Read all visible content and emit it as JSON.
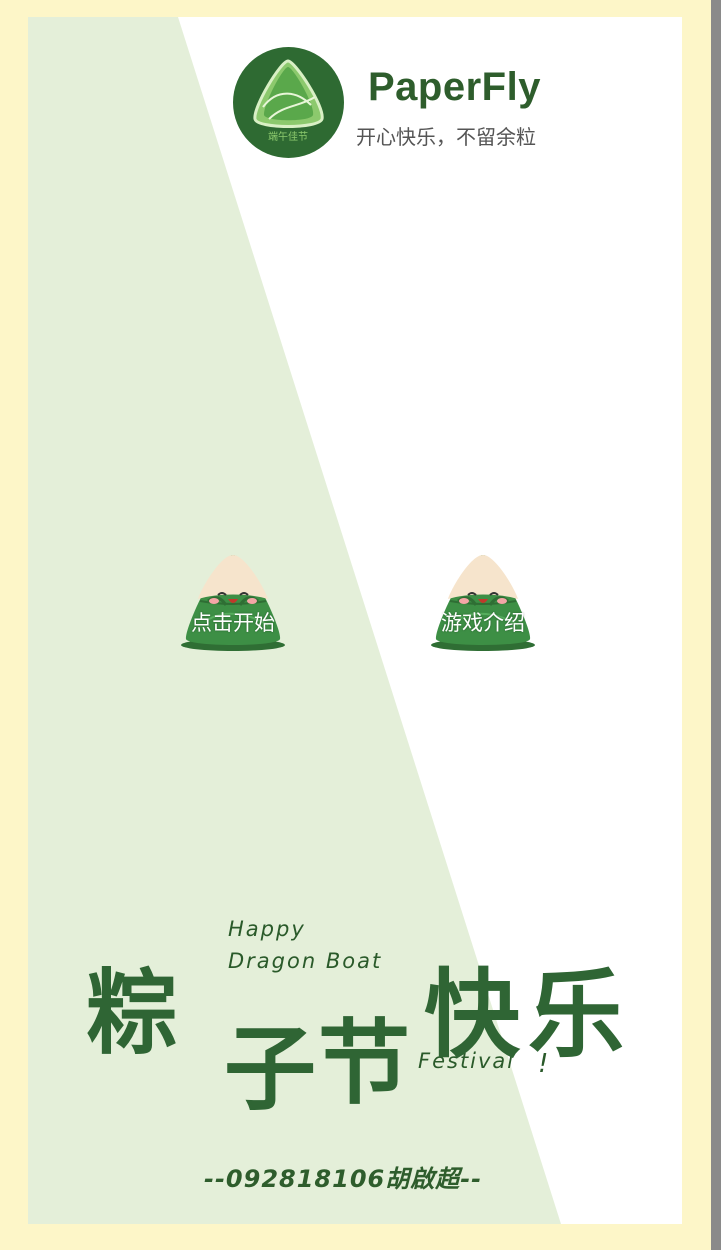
{
  "app": {
    "title": "PaperFly",
    "subtitle": "开心快乐，不留余粒",
    "logo_text": "端午佳节"
  },
  "buttons": {
    "start_label": "点击开始",
    "intro_label": "游戏介绍"
  },
  "banner": {
    "en_line1": "Happy",
    "en_line2": "Dragon Boat",
    "en_line3": "Festival",
    "exclaim": "!",
    "zh_1": "粽",
    "zh_2": "子",
    "zh_3": "节",
    "zh_4": "快",
    "zh_5": "乐"
  },
  "footer": {
    "signature": "--092818106胡啟超--"
  },
  "colors": {
    "page_bg": "#fdf6c8",
    "diagonal_panel": "#e4efd9",
    "brand_green": "#2e6a32",
    "zongzi_green": "#3d8f45",
    "zongzi_rice": "#f6e4cc"
  },
  "icons": {
    "logo": "zongzi-logo-icon",
    "start": "zongzi-mascot-icon",
    "intro": "zongzi-mascot-icon"
  }
}
